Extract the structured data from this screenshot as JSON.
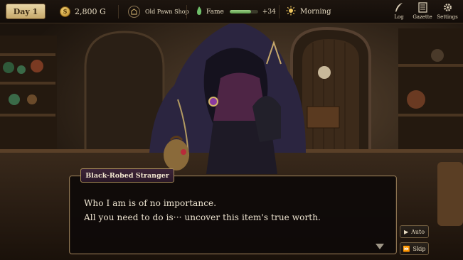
{
  "hud": {
    "day_label": "Day 1",
    "gold": "2,800 G",
    "shop_name": "Old Pawn Shop",
    "fame_label": "Fame",
    "fame_progress": 0.75,
    "fame_delta": "+34",
    "time_of_day": "Morning",
    "menu": {
      "log": "Log",
      "gazette": "Gazette",
      "settings": "Settings"
    }
  },
  "dialogue": {
    "speaker": "Black-Robed Stranger",
    "lines": [
      "Who I am is of no importance.",
      "All you need to do is··· uncover this item's true worth."
    ],
    "auto_label": "Auto",
    "skip_label": "Skip"
  },
  "icons": {
    "gold": "coin-icon",
    "shop": "shop-icon",
    "fame": "flame-icon",
    "time": "sun-icon",
    "log": "quill-icon",
    "gazette": "newspaper-icon",
    "settings": "gear-icon",
    "advance": "triangle-down-icon",
    "auto": "play-icon",
    "skip": "fast-forward-icon"
  },
  "colors": {
    "accent_gold": "#c6a86a",
    "fame_bar": "#6fae5a",
    "nameplate": "#3d2538"
  }
}
